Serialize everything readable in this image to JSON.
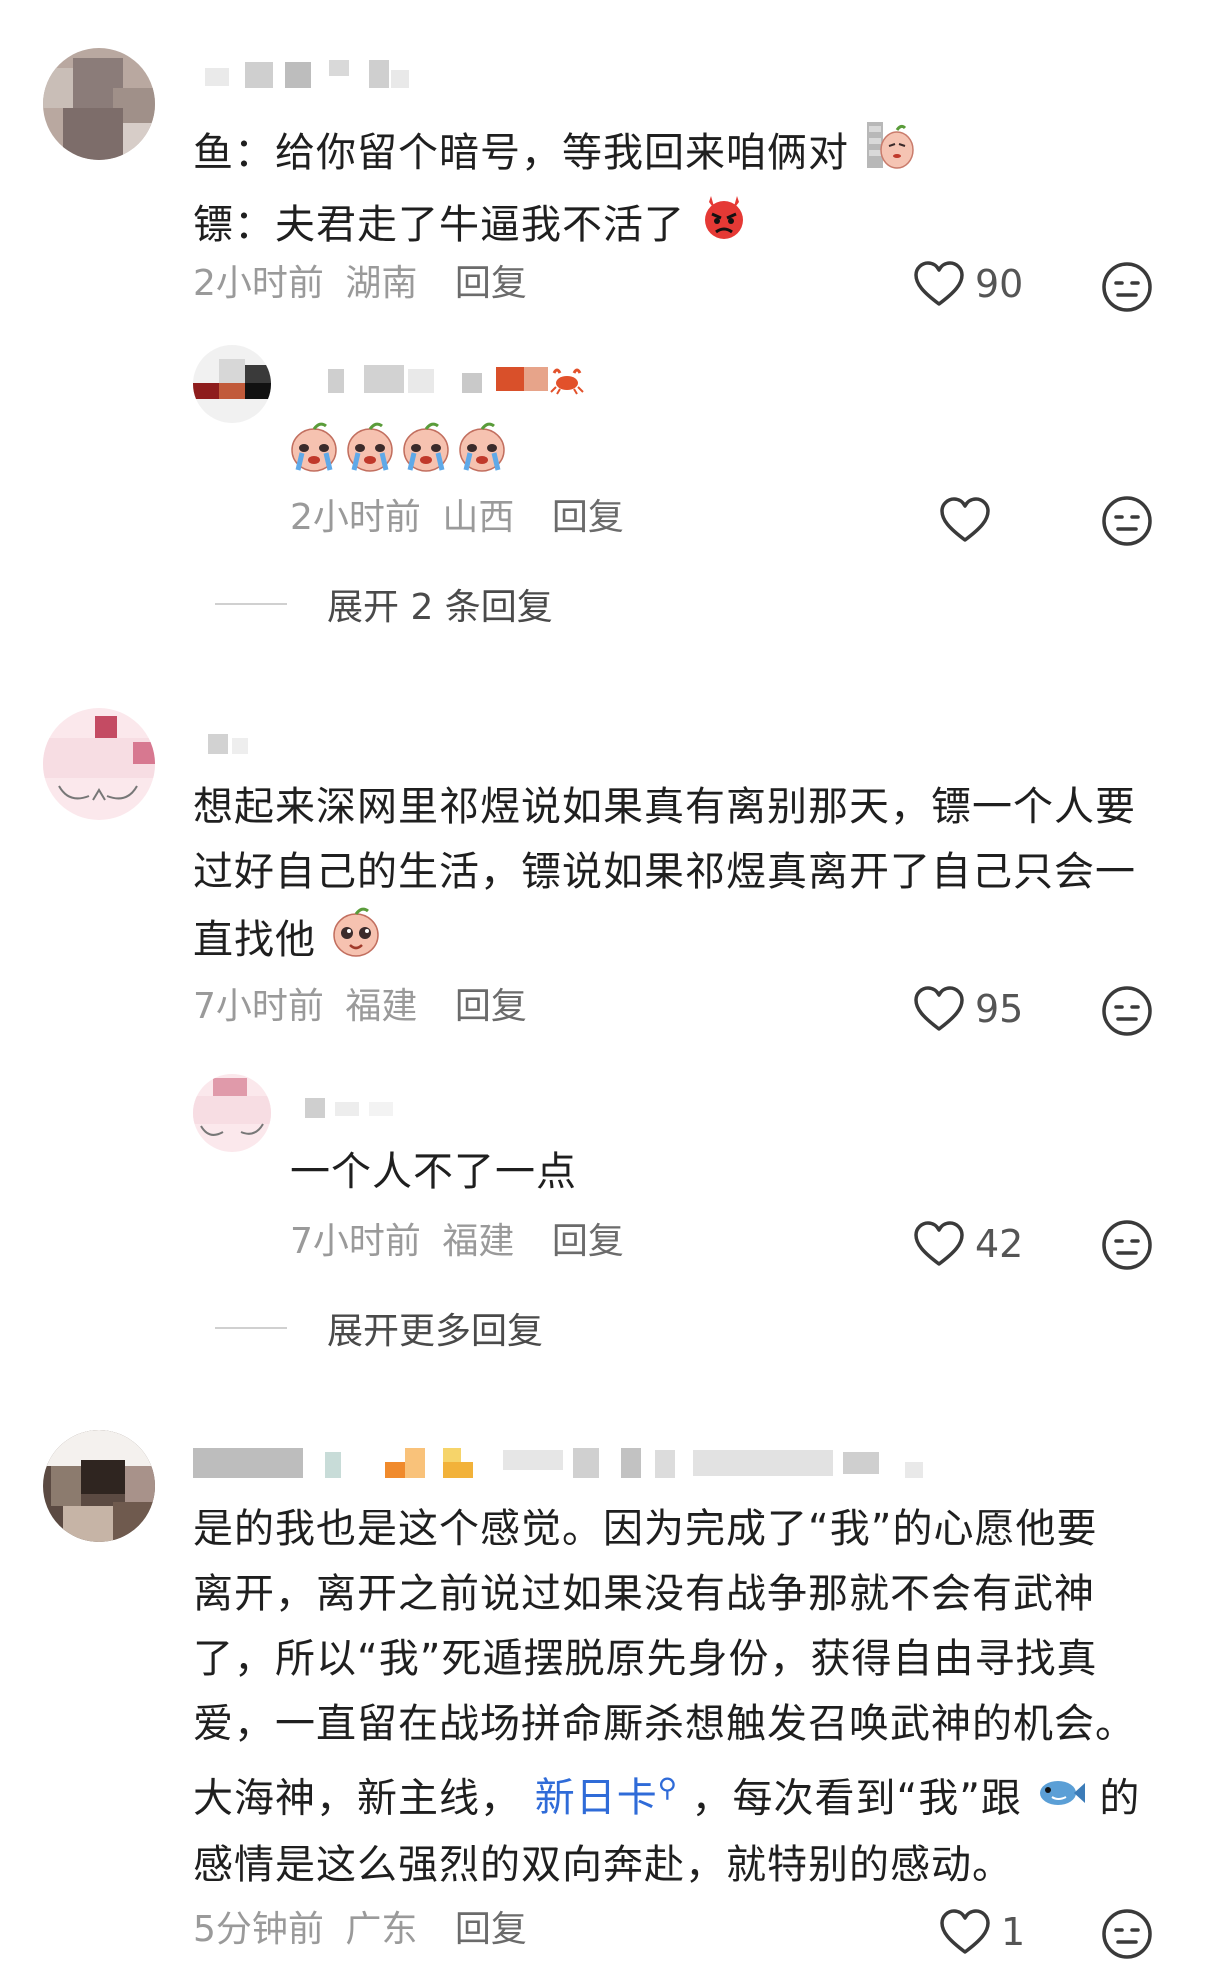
{
  "comments": [
    {
      "text_lines": [
        "鱼：给你留个暗号，等我回来咱俩对",
        "镖：夫君走了牛逼我不活了"
      ],
      "time": "2小时前",
      "location": "湖南",
      "reply_label": "回复",
      "likes": "90",
      "reply": {
        "text": "",
        "time": "2小时前",
        "location": "山西",
        "reply_label": "回复",
        "likes": ""
      },
      "expand_label": "展开 2 条回复"
    },
    {
      "text_lines": [
        "想起来深网里祁煜说如果真有离别那天，镖一个人要",
        "过好自己的生活，镖说如果祁煜真离开了自己只会一",
        "直找他"
      ],
      "time": "7小时前",
      "location": "福建",
      "reply_label": "回复",
      "likes": "95",
      "reply": {
        "text": "一个人不了一点",
        "time": "7小时前",
        "location": "福建",
        "reply_label": "回复",
        "likes": "42"
      },
      "expand_label": "展开更多回复"
    },
    {
      "text_lines": [
        "是的我也是这个感觉。因为完成了“我”的心愿他要",
        "离开，离开之前说过如果没有战争那就不会有武神",
        "了，所以“我”死遁摆脱原先身份，获得自由寻找真",
        "爱，一直留在战场拼命厮杀想触发召唤武神的机会。",
        "大海神，新主线，",
        "感情是这么强烈的双向奔赴，就特别的感动。"
      ],
      "link_text": "新日卡",
      "line5_tail_a": "，每次看到“我”跟",
      "line5_tail_b": "的",
      "time": "5分钟前",
      "location": "广东",
      "reply_label": "回复",
      "likes": "1"
    }
  ],
  "icons": {
    "like": "heart-outline-icon",
    "dislike": "meh-face-icon",
    "search": "search-icon"
  },
  "colors": {
    "link": "#2f6bd8",
    "meta": "#9a9a9a"
  }
}
